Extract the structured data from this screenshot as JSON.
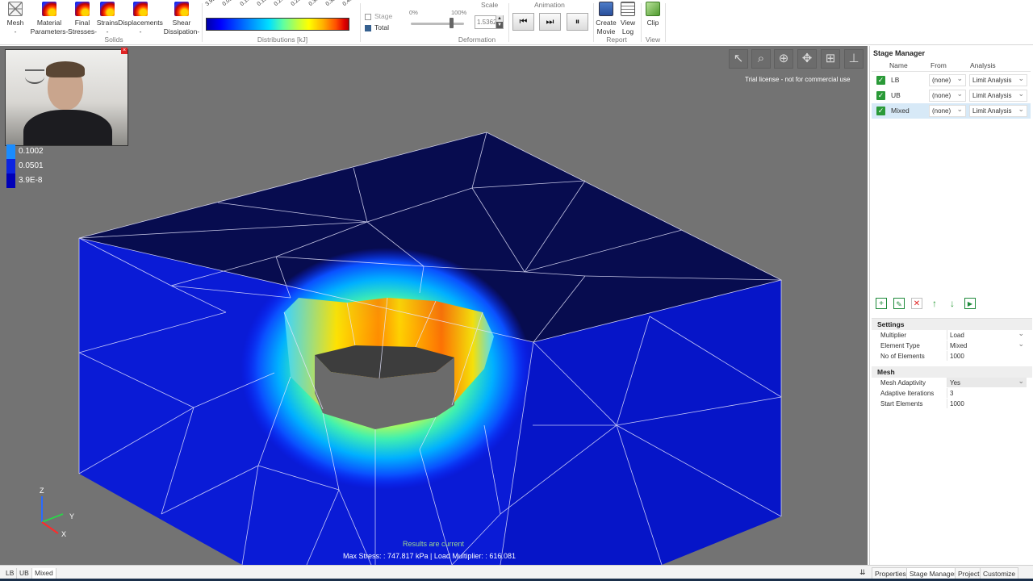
{
  "ribbon": {
    "mesh_label": "Mesh",
    "mesh_sub": "-",
    "material_label": "Material",
    "material_sub": "Parameters-",
    "final_label": "Final",
    "final_sub": "Stresses-",
    "strains_label": "Strains",
    "strains_sub": "-",
    "displacements_label": "Displacements",
    "displacements_sub": "-",
    "shear_label": "Shear",
    "shear_sub": "Dissipation-",
    "solids_group": "Solids",
    "distributions_group": "Distributions [kJ]",
    "colorbar_ticks": [
      "3.9E-8",
      "0.0501",
      "0.1002",
      "0.1503",
      "0.2004",
      "0.2505",
      "0.3006",
      "0.3507",
      "0.4008"
    ],
    "stage_label": "Stage",
    "total_label": "Total",
    "scale_label": "Scale",
    "pct_min": "0%",
    "pct_max": "100%",
    "scale_value": "1.5362",
    "scale_fraction": 0.75,
    "deformation_group": "Deformation",
    "animation_label": "Animation",
    "create_label": "Create",
    "create_sub": "Movie",
    "viewlog_label": "View",
    "viewlog_sub": "Log",
    "report_group": "Report",
    "clip_label": "Clip",
    "view_group": "View",
    "icons": [
      "mesh-icon",
      "distribution-icon",
      "movie-icon",
      "log-icon",
      "clip-icon",
      "skip-back-icon",
      "step-forward-icon",
      "pause-icon"
    ]
  },
  "viewport": {
    "legend": [
      {
        "value": "0.1002",
        "color": "#1a8cff"
      },
      {
        "value": "0.0501",
        "color": "#0c24e0"
      },
      {
        "value": "3.9E-8",
        "color": "#0000b8"
      }
    ],
    "license_text": "Trial license - not for commercial use",
    "status_text": "Results are current",
    "stress_text": "Max Stress:  : 747.817 kPa | Load Multiplier:  : 616.081",
    "axis_z": "Z",
    "axis_y": "Y",
    "axis_x": "X",
    "tools": [
      "select-arrow-icon",
      "zoom-icon",
      "zoom-extents-icon",
      "pan-icon",
      "grid-icon",
      "axes-icon"
    ]
  },
  "stage_manager": {
    "title": "Stage Manager",
    "col_name": "Name",
    "col_from": "From",
    "col_analysis": "Analysis",
    "rows": [
      {
        "name": "LB",
        "from": "(none)",
        "analysis": "Limit Analysis"
      },
      {
        "name": "UB",
        "from": "(none)",
        "analysis": "Limit Analysis"
      },
      {
        "name": "Mixed",
        "from": "(none)",
        "analysis": "Limit Analysis"
      }
    ]
  },
  "settings": {
    "title": "Settings",
    "multiplier_label": "Multiplier",
    "multiplier_value": "Load",
    "element_type_label": "Element Type",
    "element_type_value": "Mixed",
    "no_elements_label": "No of Elements",
    "no_elements_value": "1000"
  },
  "mesh": {
    "title": "Mesh",
    "adaptivity_label": "Mesh Adaptivity",
    "adaptivity_value": "Yes",
    "iterations_label": "Adaptive Iterations",
    "iterations_value": "3",
    "start_label": "Start Elements",
    "start_value": "1000"
  },
  "bottom": {
    "tabs": [
      "LB",
      "UB",
      "Mixed"
    ],
    "right_tabs": [
      "Properties",
      "Stage Manager",
      "Project",
      "Customize"
    ]
  }
}
